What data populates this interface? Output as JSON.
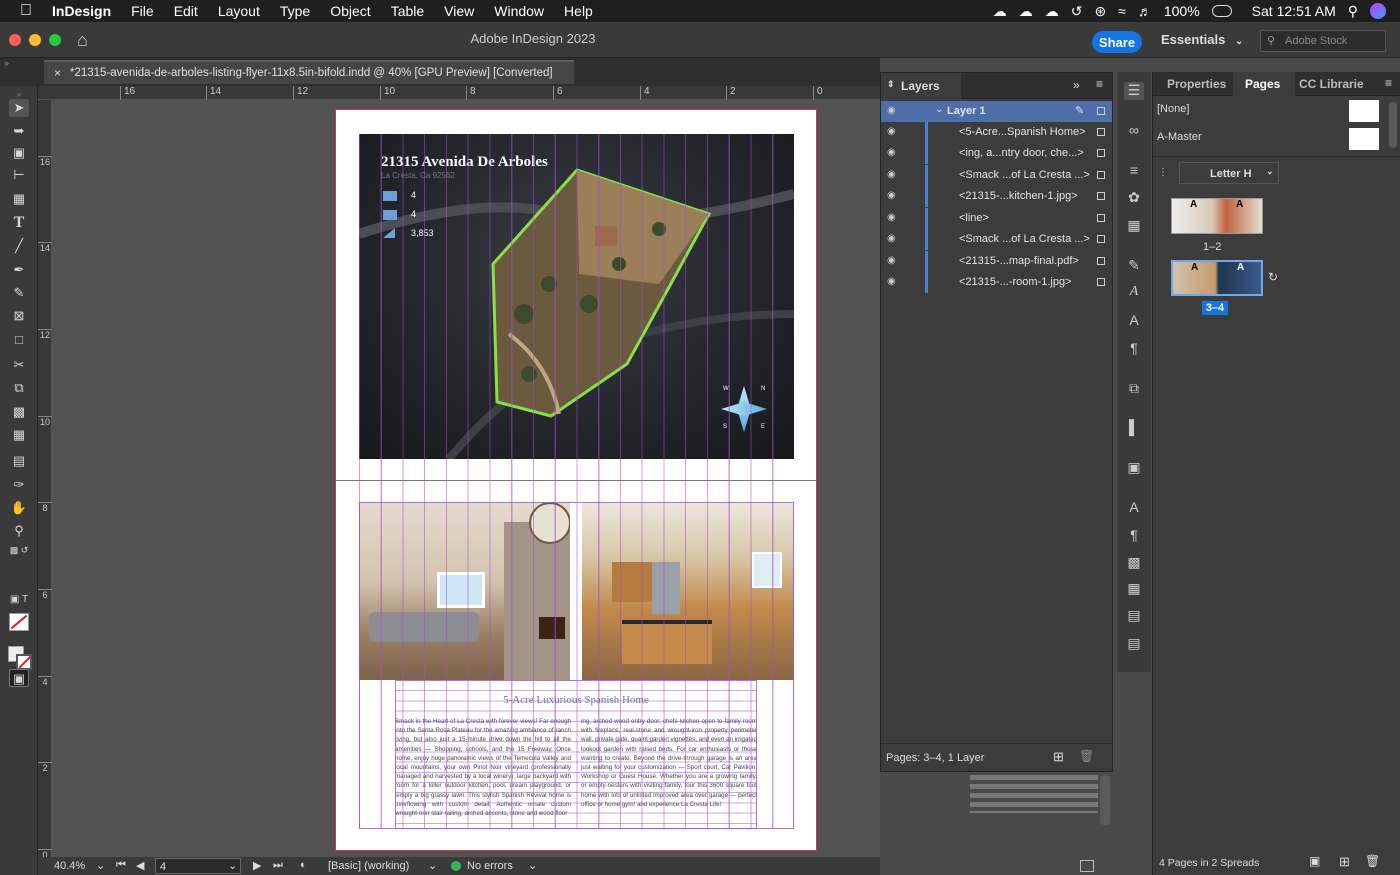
{
  "menubar": {
    "app": "InDesign",
    "items": [
      "File",
      "Edit",
      "Layout",
      "Type",
      "Object",
      "Table",
      "View",
      "Window",
      "Help"
    ],
    "battery": "100%",
    "clock": "Sat 12:51 AM"
  },
  "window": {
    "title": "Adobe InDesign 2023",
    "share_label": "Share",
    "workspace": "Essentials",
    "stock_placeholder": "Adobe Stock"
  },
  "document": {
    "tab_label": "*21315-avenida-de-arboles-listing-flyer-11x8.5in-bifold.indd @ 40% [GPU Preview] [Converted]"
  },
  "ruler": {
    "h_ticks": [
      "16",
      "14",
      "12",
      "10",
      "8",
      "6",
      "4",
      "2",
      "0"
    ],
    "v_ticks": [
      "16",
      "14",
      "12",
      "10",
      "8",
      "6",
      "4",
      "2",
      "0"
    ]
  },
  "flyer": {
    "title": "21315 Avenida De Arboles",
    "location": "La Cresta, Ca 92562",
    "stats": [
      "4",
      "4",
      "3,853"
    ],
    "headline": "5-Acre Luxurious Spanish Home",
    "body_left": "Smack in the Heart of La Cresta with forever views! Far enough into the Santa Rosa Plateau for the amazing ambiance of ranch living, but also just a 15-minute drive down the hill to all the amenities — Shopping, schools, and the 15 Freeway. Once home, enjoy huge panoramic views of the Temecula Valley and local mountains, your own Pinot Noir vineyard (professionally managed and harvested by a local winery), large backyard with room for a killer outdoor kitchen, pool, dream playground, or simply a big grassy lawn. This stylish Spanish Revival home is overflowing with custom detail. Authentic ornate custom wrought-iron stair railing, arched accents, stone and wood floor",
    "body_right": "ing, arched wood entry door, chefs kitchen open to family room with fireplace, real-stone and wrought-iron property perimeter wall, private gate, quaint garden vignettes, and even an irrigated lookout garden with raised beds. For car enthusiasts or those wanting to create. Beyond the drive-through garage is an area just waiting for your customization — Sport court, Car Pavilion, Workshop or Guest House. Whether you are a growing family, or empty-nesters with visiting family, tour this 3600 square foot home with lots of unlisted improved area over garage — perfect office or home gym! and experience La Cresta Life!",
    "compass": [
      "N",
      "E",
      "S",
      "W"
    ]
  },
  "status": {
    "zoom": "40.4%",
    "page": "4",
    "style": "[Basic] (working)",
    "preflight": "No errors"
  },
  "layers": {
    "tab": "Layers",
    "layer_name": "Layer 1",
    "items": [
      "<5-Acre...Spanish Home>",
      "<ing, a...ntry door, che...>",
      "<Smack ...of La Cresta ...>",
      "<21315-...kitchen-1.jpg>",
      "<line>",
      "<Smack ...of La Cresta ...>",
      "<21315-...map-final.pdf>",
      "<21315-...-room-1.jpg>"
    ],
    "footer": "Pages: 3–4, 1 Layer"
  },
  "pages_panel": {
    "tabs": [
      "Properties",
      "Pages",
      "CC Librarie"
    ],
    "masters": [
      "[None]",
      "A-Master"
    ],
    "size": "Letter H",
    "spreads": [
      "1–2",
      "3–4"
    ],
    "footer": "4 Pages in 2 Spreads",
    "master_letter": "A"
  },
  "colors": {
    "accent": "#1473e6",
    "selection": "#4a7fd4",
    "guide": "#a24cd6",
    "property_outline": "#8ae04a"
  }
}
